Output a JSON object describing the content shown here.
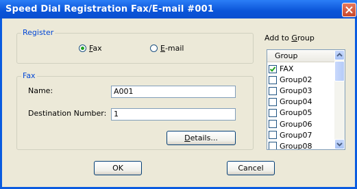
{
  "window": {
    "title": "Speed Dial Registration Fax/E-mail #001"
  },
  "register": {
    "label": "Register",
    "options": [
      {
        "label": "Fax",
        "mnemonic": "F",
        "selected": true
      },
      {
        "label": "E-mail",
        "mnemonic": "E",
        "selected": false
      }
    ]
  },
  "fax": {
    "label": "Fax",
    "name_label": "Name:",
    "name_value": "A001",
    "dest_label": "Destination Number:",
    "dest_value": "1",
    "details_label": "Details..."
  },
  "group_panel": {
    "label": "Add to Group",
    "header": "Group",
    "items": [
      {
        "label": "FAX",
        "checked": true
      },
      {
        "label": "Group02",
        "checked": false
      },
      {
        "label": "Group03",
        "checked": false
      },
      {
        "label": "Group04",
        "checked": false
      },
      {
        "label": "Group05",
        "checked": false
      },
      {
        "label": "Group06",
        "checked": false
      },
      {
        "label": "Group07",
        "checked": false
      },
      {
        "label": "Group08",
        "checked": false
      }
    ]
  },
  "buttons": {
    "ok": "OK",
    "cancel": "Cancel"
  },
  "colors": {
    "titlebar": "#0a54d8",
    "dialog_bg": "#ece9d8",
    "group_label": "#0046d5",
    "check": "#21a121"
  }
}
